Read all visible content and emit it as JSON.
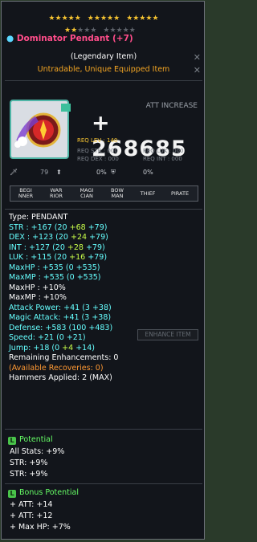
{
  "stars": {
    "row1": [
      true,
      true,
      true,
      true,
      true,
      true,
      true,
      true,
      true,
      true,
      true,
      true,
      true,
      true,
      true
    ],
    "row2": [
      true,
      true,
      false,
      false,
      false,
      false,
      false,
      false,
      false,
      false
    ]
  },
  "item": {
    "name": "Dominator Pendant (+7)",
    "rarity_label": "(Legendary Item)",
    "trade_label": "Untradable, Unique Equipped Item",
    "att_increase_label": "ATT INCREASE",
    "att_increase_value": "+ 268685",
    "req_lev": "REQ LEV : 140",
    "req_str": "REQ STR : 000",
    "req_luk": "REQ LUK : 000",
    "req_dex": "REQ DEX : 000",
    "req_int": "REQ INT : 000"
  },
  "mini": {
    "durability_value": "79",
    "pct1": "0%",
    "pct2": "0%"
  },
  "jobs": [
    "BEGI NNER",
    "WAR RIOR",
    "MAGI CIAN",
    "BOW MAN",
    "THIEF",
    "PIRATE"
  ],
  "stats": {
    "type": "Type: PENDANT",
    "str": {
      "label": "STR : +167 (20 ",
      "a": "+68",
      "b": " +79",
      "c": ")"
    },
    "dex": {
      "label": "DEX : +123 (20 ",
      "a": "+24",
      "b": " +79",
      "c": ")"
    },
    "int": {
      "label": "INT : +127 (20 ",
      "a": "+28",
      "b": " +79",
      "c": ")"
    },
    "luk": {
      "label": "LUK : +115 (20 ",
      "a": "+16",
      "b": " +79",
      "c": ")"
    },
    "maxhp": {
      "label": "MaxHP : +535 (0 ",
      "b": "+535",
      "c": ")"
    },
    "maxmp": {
      "label": "MaxMP : +535 (0 ",
      "b": "+535",
      "c": ")"
    },
    "maxhp_pct": "MaxHP : +10%",
    "maxmp_pct": "MaxMP : +10%",
    "attack": {
      "label": "Attack Power: +41 (3 ",
      "b": "+38",
      "c": ")"
    },
    "magic": {
      "label": "Magic Attack: +41 (3 ",
      "b": "+38",
      "c": ")"
    },
    "defense": {
      "label": "Defense: +583 (100 ",
      "b": "+483",
      "c": ")"
    },
    "speed": {
      "label": "Speed: +21 (0 ",
      "b": "+21",
      "c": ")"
    },
    "jump": {
      "label": "Jump: +18 (0 ",
      "a": "+4",
      "b": " +14",
      "c": ")"
    },
    "remaining": "Remaining Enhancements: 0",
    "recoveries": "(Available Recoveries: 0)",
    "hammers": "Hammers Applied: 2 (MAX)"
  },
  "enhance_button": "ENHANCE ITEM",
  "potential": {
    "header": "Potential",
    "lines": [
      "All Stats: +9%",
      "STR: +9%",
      "STR: +9%"
    ]
  },
  "bonus_potential": {
    "header": "Bonus Potential",
    "lines": [
      "+ ATT: +14",
      "+ ATT: +12",
      "+ Max HP: +7%"
    ]
  },
  "colors": {
    "title": "#ff4d8a",
    "legendary": "#f5a623",
    "cyan_stat": "#66ffff",
    "green_stat": "#c9ff4a",
    "potential": "#66ff66"
  }
}
